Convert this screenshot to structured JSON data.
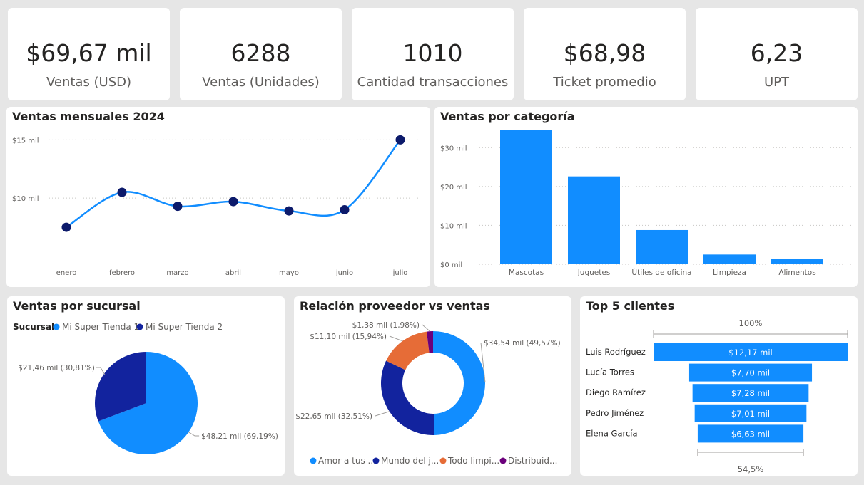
{
  "kpis": [
    {
      "value": "$69,67 mil",
      "label": "Ventas (USD)"
    },
    {
      "value": "6288",
      "label": "Ventas (Unidades)"
    },
    {
      "value": "1010",
      "label": "Cantidad transacciones"
    },
    {
      "value": "$68,98",
      "label": "Ticket promedio"
    },
    {
      "value": "6,23",
      "label": "UPT"
    }
  ],
  "panels": {
    "monthly": {
      "title": "Ventas mensuales 2024"
    },
    "category": {
      "title": "Ventas por categoría"
    },
    "branch": {
      "title": "Ventas por sucursal"
    },
    "supplier": {
      "title": "Relación proveedor vs ventas"
    },
    "clients": {
      "title": "Top 5 clientes"
    }
  },
  "colors": {
    "primary": "#118dff",
    "dark_blue": "#12239e",
    "navy_marker": "#0c1a6b",
    "orange": "#e66c37",
    "purple": "#6b007b"
  },
  "chart_data": [
    {
      "type": "line",
      "title": "Ventas mensuales 2024",
      "categories": [
        "enero",
        "febrero",
        "marzo",
        "abril",
        "mayo",
        "junio",
        "julio"
      ],
      "values": [
        7.5,
        10.5,
        9.3,
        9.7,
        8.9,
        9.0,
        15.0
      ],
      "unit": "mil",
      "yticks": [
        "$10 mil",
        "$15 mil"
      ],
      "ylim": [
        5,
        16
      ],
      "grid": true
    },
    {
      "type": "bar",
      "title": "Ventas por categoría",
      "categories": [
        "Mascotas",
        "Juguetes",
        "Útiles de oficina",
        "Limpieza",
        "Alimentos"
      ],
      "values": [
        34.5,
        22.6,
        8.8,
        2.5,
        1.4
      ],
      "unit": "mil",
      "yticks": [
        "$0 mil",
        "$10 mil",
        "$20 mil",
        "$30 mil"
      ],
      "ylim": [
        0,
        35
      ],
      "grid": true
    },
    {
      "type": "pie",
      "title": "Ventas por sucursal",
      "legend_title": "Sucursal",
      "legend_position": "top-left",
      "slices": [
        {
          "name": "Mi Super Tienda 1",
          "value": 48.21,
          "label": "$48,21 mil (69,19%)",
          "color": "#118dff"
        },
        {
          "name": "Mi Super Tienda 2",
          "value": 21.46,
          "label": "$21,46 mil (30,81%)",
          "color": "#12239e"
        }
      ]
    },
    {
      "type": "pie",
      "subtype": "donut",
      "title": "Relación proveedor vs ventas",
      "legend_position": "bottom",
      "slices": [
        {
          "name": "Amor a tus ...",
          "value": 34.54,
          "label": "$34,54 mil (49,57%)",
          "color": "#118dff"
        },
        {
          "name": "Mundo del j...",
          "value": 22.65,
          "label": "$22,65 mil (32,51%)",
          "color": "#12239e"
        },
        {
          "name": "Todo limpi...",
          "value": 11.1,
          "label": "$11,10 mil (15,94%)",
          "color": "#e66c37"
        },
        {
          "name": "Distribuid...",
          "value": 1.38,
          "label": "$1,38 mil (1,98%)",
          "color": "#6b007b"
        }
      ]
    },
    {
      "type": "funnel",
      "title": "Top 5 clientes",
      "top_label": "100%",
      "bottom_label": "54,5%",
      "categories": [
        "Luis Rodríguez",
        "Lucía Torres",
        "Diego Ramírez",
        "Pedro Jiménez",
        "Elena García"
      ],
      "values": [
        12.17,
        7.7,
        7.28,
        7.01,
        6.63
      ],
      "labels": [
        "$12,17 mil",
        "$7,70 mil",
        "$7,28 mil",
        "$7,01 mil",
        "$6,63 mil"
      ]
    }
  ]
}
